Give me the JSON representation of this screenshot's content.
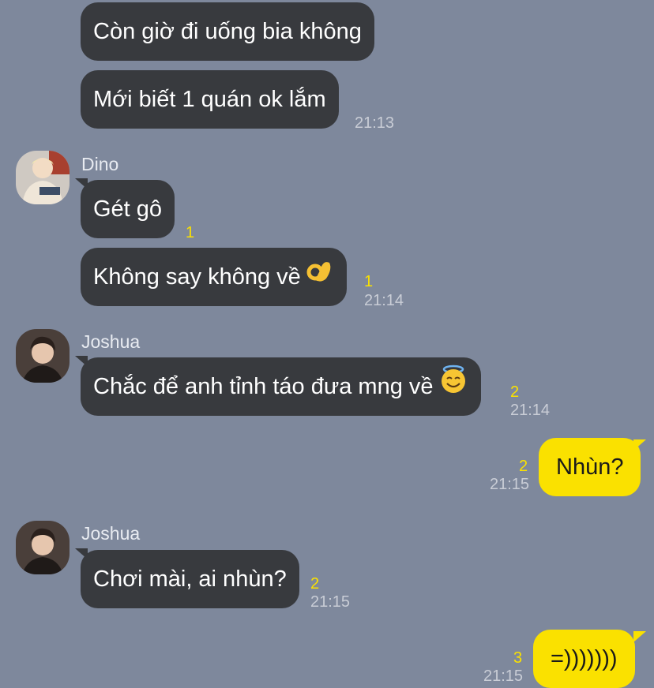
{
  "messages": {
    "m1": {
      "text": "Còn giờ đi uống bia không"
    },
    "m2": {
      "text": "Mới biết 1 quán ok lắm",
      "time": "21:13"
    },
    "m3": {
      "sender": "Dino",
      "text": "Gét gô",
      "unread": "1"
    },
    "m4": {
      "text": "Không say không về",
      "emoji": "ok-hand-emoji",
      "unread": "1",
      "time": "21:14"
    },
    "m5": {
      "sender": "Joshua",
      "text": "Chắc để anh tỉnh táo đưa mng về",
      "emoji": "smiling-halo-emoji",
      "unread": "2",
      "time": "21:14"
    },
    "m6": {
      "text": "Nhùn?",
      "unread": "2",
      "time": "21:15",
      "outgoing": true
    },
    "m7": {
      "sender": "Joshua",
      "text": "Chơi mài, ai nhùn?",
      "unread": "2",
      "time": "21:15"
    },
    "m8": {
      "text": "=)))))))",
      "unread": "3",
      "time": "21:15",
      "outgoing": true
    }
  },
  "colors": {
    "background": "#7e889c",
    "incoming_bubble": "#383a3e",
    "outgoing_bubble": "#fae100",
    "unread_count": "#fae100",
    "timestamp": "#c9cdd6"
  }
}
